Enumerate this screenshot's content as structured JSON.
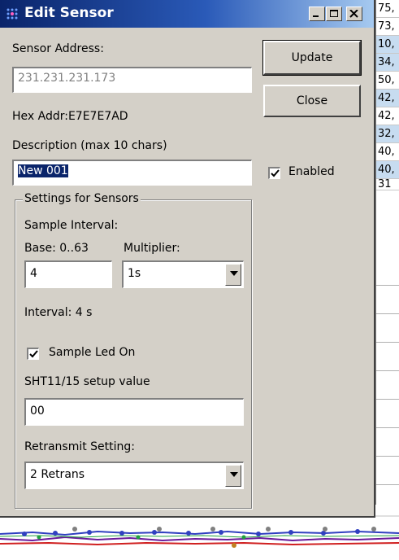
{
  "dialog": {
    "title": "Edit Sensor",
    "sensor_address_label": "Sensor Address:",
    "sensor_address_value": "231.231.231.173",
    "hex_addr": "Hex Addr:E7E7E7AD",
    "description_label": "Description (max 10 chars)",
    "description_value": "New 001",
    "enabled_label": "Enabled",
    "enabled_checked": true,
    "update_button": "Update",
    "close_button": "Close"
  },
  "settings": {
    "group_title": "Settings for Sensors",
    "sample_interval_label": "Sample Interval:",
    "base_label": "Base: 0..63",
    "multiplier_label": "Multiplier:",
    "base_value": "4",
    "multiplier_value": "1s",
    "interval_text": "Interval: 4 s",
    "sample_led_label": "Sample Led On",
    "sample_led_checked": true,
    "sht_label": "SHT11/15 setup value",
    "sht_value": "00",
    "retransmit_label": "Retransmit Setting:",
    "retransmit_value": "2 Retrans"
  },
  "background": {
    "strip_values": [
      "75,",
      "73,",
      "10,",
      "34,",
      "50,",
      "42,",
      "42,",
      "32,",
      "40,",
      "40,",
      "31"
    ]
  },
  "colors": {
    "dialog_face": "#d4d0c8",
    "titlebar_start": "#0a246a",
    "titlebar_end": "#a6caf0",
    "selection": "#0a246a"
  }
}
